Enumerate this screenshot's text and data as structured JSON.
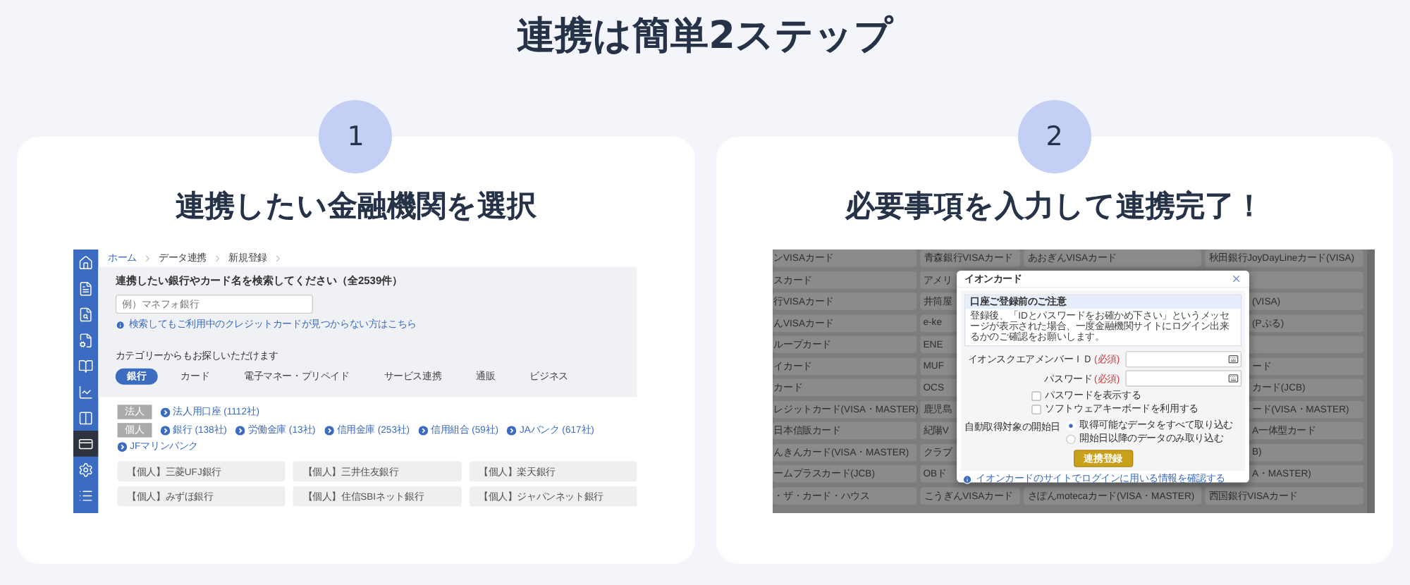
{
  "heading": "連携は簡単2ステップ",
  "steps": [
    {
      "number": "1",
      "title": "連携したい金融機関を選択",
      "screen": {
        "kind": "search",
        "sidebar": [
          {
            "selected": false
          },
          {
            "selected": false
          },
          {
            "selected": false
          },
          {
            "selected": false
          },
          {
            "selected": false
          },
          {
            "selected": false
          },
          {
            "selected": false
          },
          {
            "selected": true
          },
          {
            "selected": false
          },
          {
            "selected": false
          }
        ],
        "breadcrumbs": [
          {
            "label": "ホーム",
            "link": true
          },
          {
            "label": "データ連携",
            "link": false
          },
          {
            "label": "新規登録",
            "link": false
          }
        ],
        "search": {
          "heading": "連携したい銀行やカード名を検索してください（全2539件）",
          "placeholder": "例）マネフォ銀行",
          "help_link": "検索してもご利用中のクレジットカードが見つからない方はこちら"
        },
        "category_heading": "カテゴリーからもお探しいただけます",
        "category_tabs": [
          {
            "label": "銀行",
            "selected": true
          },
          {
            "label": "カード",
            "selected": false
          },
          {
            "label": "電子マネー・プリペイド",
            "selected": false
          },
          {
            "label": "サービス連携",
            "selected": false
          },
          {
            "label": "通販",
            "selected": false
          },
          {
            "label": "ビジネス",
            "selected": false
          }
        ],
        "groups": [
          {
            "badge": "法人",
            "links": [
              "法人用口座 (1112社)"
            ]
          },
          {
            "badge": "個人",
            "links": [
              "銀行 (138社)",
              "労働金庫 (13社)",
              "信用金庫 (253社)",
              "信用組合 (59社)",
              "JAバンク (617社)",
              "JFマリンバンク"
            ]
          }
        ],
        "banks": [
          "【個人】三菱UFJ銀行",
          "【個人】三井住友銀行",
          "【個人】楽天銀行",
          "【個人】みずほ銀行",
          "【個人】住信SBIネット銀行",
          "【個人】ジャパンネット銀行"
        ]
      }
    },
    {
      "number": "2",
      "title": "必要事項を入力して連携完了！",
      "screen": {
        "kind": "form",
        "background_rows": [
          {
            "a": "ンVISAカード",
            "b": "青森銀行VISAカード",
            "c": "あおぎんVISAカード",
            "d": "秋田銀行JoyDayLineカード(VISA)"
          },
          {
            "a": "スカード",
            "b": "アメリ"
          },
          {
            "a": "行VISAカード",
            "b": "井筒屋",
            "d": "(VISA)"
          },
          {
            "a": "んVISAカード",
            "b": "e-ke",
            "d": "(Pぷる)"
          },
          {
            "a": "ループカード",
            "b": "ENE"
          },
          {
            "a": "イカード",
            "b": "MUF",
            "d": "ード"
          },
          {
            "a": "カード",
            "b": "OCS",
            "d": "カード(JCB)"
          },
          {
            "a": "レジットカード(VISA・MASTER)",
            "b": "鹿児島",
            "d": "ード(VISA・MASTER)"
          },
          {
            "a": "日本信販カード",
            "b": "紀陽V",
            "d": "A一体型カード"
          },
          {
            "a": "んきんカード(VISA・MASTER)",
            "b": "クラブ",
            "d": "B)"
          },
          {
            "a": "ームプラスカード(JCB)",
            "b": "OBド",
            "d": "A・MASTER)"
          },
          {
            "a": "・ザ・カード・ハウス",
            "b": "こうぎんVISAカード",
            "c": "さぽんmotecaカード(VISA・MASTER)",
            "d": "西国銀行VISAカード"
          }
        ],
        "dialog": {
          "title": "イオンカード",
          "notice_title": "口座ご登録前のご注意",
          "notice_text": "登録後、「IDとパスワードをお確かめ下さい」というメッセージが表示された場合、一度金融機関サイトにログイン出来るかのご確認をお願いします。",
          "fields": [
            {
              "label": "イオンスクエアメンバーＩＤ",
              "required": "(必須)"
            },
            {
              "label": "パスワード",
              "required": "(必須)"
            }
          ],
          "checkboxes": [
            {
              "label": "パスワードを表示する",
              "checked": false
            },
            {
              "label": "ソフトウェアキーボードを利用する",
              "checked": false
            }
          ],
          "start_label": "自動取得対象の開始日",
          "radios": [
            {
              "label": "取得可能なデータをすべて取り込む",
              "selected": true
            },
            {
              "label": "開始日以降のデータのみ取り込む",
              "selected": false
            }
          ],
          "submit": "連携登録",
          "link": "イオンカードのサイトでログインに用いる情報を確認する"
        }
      }
    }
  ]
}
